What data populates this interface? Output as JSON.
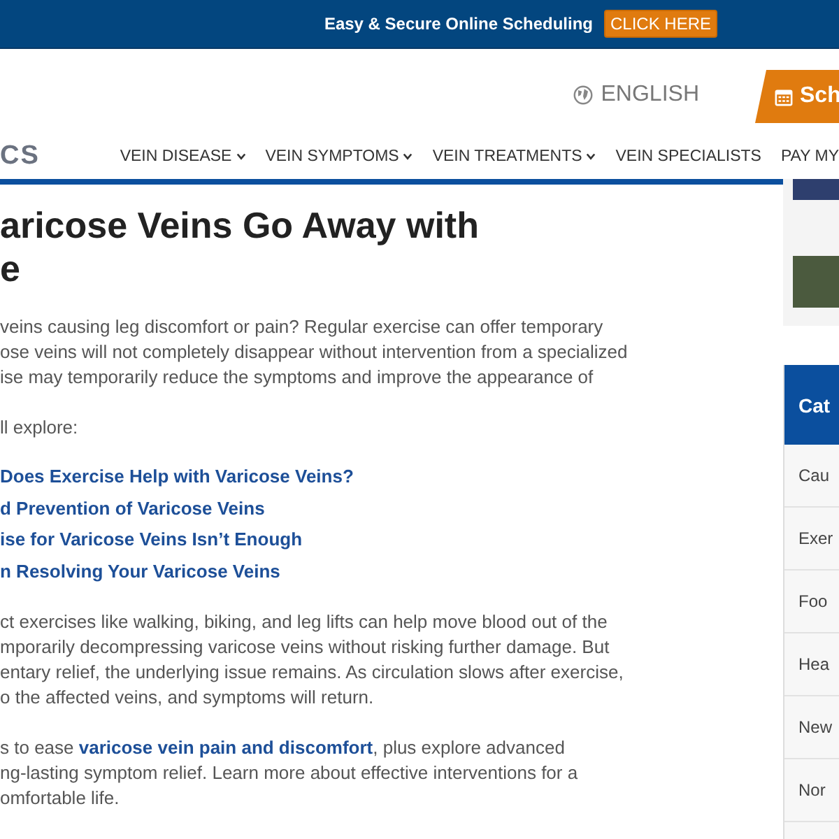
{
  "topbar": {
    "text": "Easy & Secure Online Scheduling",
    "button": "CLICK HERE"
  },
  "header": {
    "language": "ENGLISH",
    "schedule_button": "Sch",
    "logo": "CS",
    "nav": [
      {
        "label": "VEIN DISEASE",
        "dropdown": true
      },
      {
        "label": "VEIN SYMPTOMS",
        "dropdown": true
      },
      {
        "label": "VEIN TREATMENTS",
        "dropdown": true
      },
      {
        "label": "VEIN SPECIALISTS",
        "dropdown": false
      },
      {
        "label": "PAY MY",
        "dropdown": false
      }
    ]
  },
  "article": {
    "title_lines": [
      "aricose Veins Go Away with",
      "e"
    ],
    "intro": [
      "veins causing leg discomfort or pain? Regular exercise can offer temporary",
      "ose veins will not completely disappear without intervention from a specialized",
      "ise may temporarily reduce the symptoms and improve the appearance of"
    ],
    "explore": "ll explore:",
    "toc_links": [
      "Does Exercise Help with Varicose Veins?",
      "d Prevention of Varicose Veins",
      "ise for Varicose Veins Isn’t Enough",
      "n Resolving Your Varicose Veins"
    ],
    "paragraphs": [
      [
        "ct exercises like walking, biking, and leg lifts can help move blood out of the",
        "mporarily decompressing varicose veins without risking further damage. But",
        "entary relief, the underlying issue remains. As circulation slows after exercise,",
        "o the affected veins, and symptoms will return."
      ],
      [
        "s to ease **varicose vein pain and discomfort**, plus explore advanced",
        "ng-lasting symptom relief. Learn more about effective interventions for a",
        "omfortable life."
      ]
    ]
  },
  "categories": {
    "heading": "Cat",
    "items": [
      "Cau",
      "Exer",
      "Foo",
      "Hea",
      "New",
      "Nor"
    ]
  }
}
